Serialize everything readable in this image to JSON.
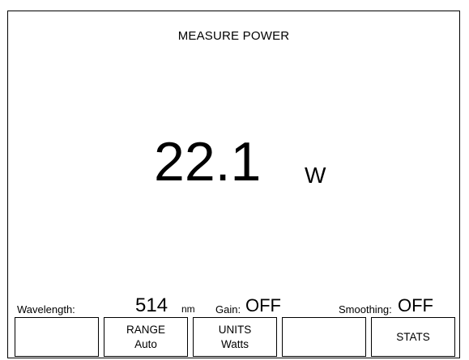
{
  "screen": {
    "title": "MEASURE POWER",
    "reading": {
      "value": "22.1",
      "unit": "W"
    }
  },
  "status": {
    "wavelength_label": "Wavelength:",
    "wavelength_value": "514",
    "wavelength_unit": "nm",
    "gain_label": "Gain:",
    "gain_value": "OFF",
    "smoothing_label": "Smoothing:",
    "smoothing_value": "OFF"
  },
  "softkeys": [
    {
      "line1": "",
      "line2": ""
    },
    {
      "line1": "RANGE",
      "line2": "Auto"
    },
    {
      "line1": "UNITS",
      "line2": "Watts"
    },
    {
      "line1": "",
      "line2": ""
    },
    {
      "line1": "STATS",
      "line2": ""
    }
  ]
}
